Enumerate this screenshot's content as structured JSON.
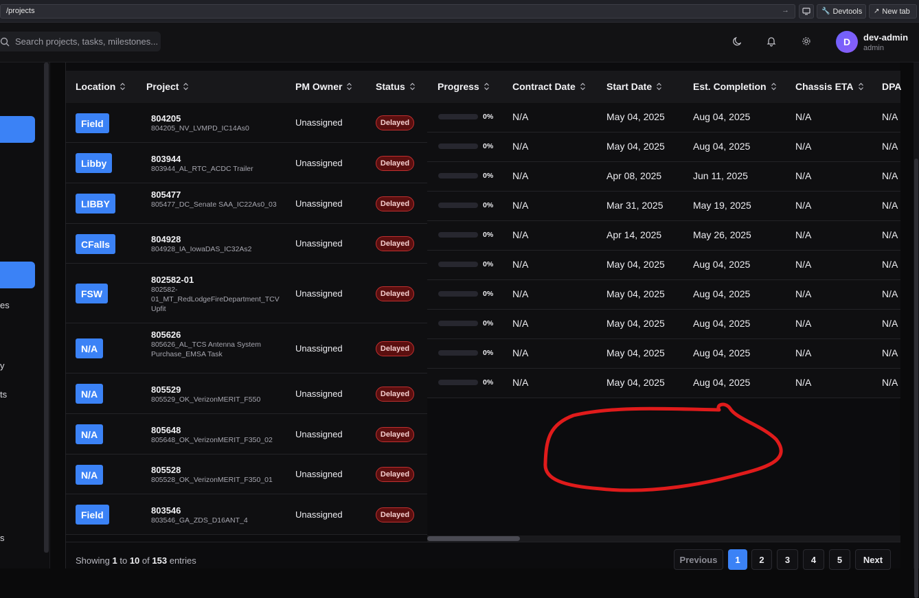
{
  "browser": {
    "url": "/projects",
    "devtools_label": "Devtools",
    "newtab_label": "New tab"
  },
  "header": {
    "search_placeholder": "Search projects, tasks, milestones...",
    "user_initial": "D",
    "user_name": "dev-admin",
    "user_role": "admin"
  },
  "sidebar": {
    "fragments": [
      "es",
      "y",
      "ts",
      "s"
    ]
  },
  "table": {
    "columns": [
      "Location",
      "Project",
      "PM Owner",
      "Status",
      "Progress",
      "Contract Date",
      "Start Date",
      "Est. Completion",
      "Chassis ETA",
      "DPA"
    ],
    "left_rows": [
      {
        "location": "Field",
        "id": "804205",
        "name": "804205_NV_LVMPD_IC14As0",
        "pm": "Unassigned",
        "status": "Delayed"
      },
      {
        "location": "Libby",
        "id": "803944",
        "name": "803944_AL_RTC_ACDC Trailer",
        "pm": "Unassigned",
        "status": "Delayed"
      },
      {
        "location": "LIBBY",
        "id": "805477",
        "name": "805477_DC_Senate SAA_IC22As0_03",
        "pm": "Unassigned",
        "status": "Delayed"
      },
      {
        "location": "CFalls",
        "id": "804928",
        "name": "804928_IA_IowaDAS_IC32As2",
        "pm": "Unassigned",
        "status": "Delayed"
      },
      {
        "location": "FSW",
        "id": "802582-01",
        "name": "802582-01_MT_RedLodgeFireDepartment_TCV Upfit",
        "pm": "Unassigned",
        "status": "Delayed"
      },
      {
        "location": "N/A",
        "id": "805626",
        "name": "805626_AL_TCS Antenna System Purchase_EMSA Task",
        "pm": "Unassigned",
        "status": "Delayed"
      },
      {
        "location": "N/A",
        "id": "805529",
        "name": "805529_OK_VerizonMERIT_F550",
        "pm": "Unassigned",
        "status": "Delayed"
      },
      {
        "location": "N/A",
        "id": "805648",
        "name": "805648_OK_VerizonMERIT_F350_02",
        "pm": "Unassigned",
        "status": "Delayed"
      },
      {
        "location": "N/A",
        "id": "805528",
        "name": "805528_OK_VerizonMERIT_F350_01",
        "pm": "Unassigned",
        "status": "Delayed"
      },
      {
        "location": "Field",
        "id": "803546",
        "name": "803546_GA_ZDS_D16ANT_4",
        "pm": "Unassigned",
        "status": "Delayed"
      }
    ],
    "right_rows": [
      {
        "progress": 0,
        "progress_label": "0%",
        "contract": "N/A",
        "start": "May 04, 2025",
        "est": "Aug 04, 2025",
        "chassis": "N/A",
        "dpa": "N/A"
      },
      {
        "progress": 0,
        "progress_label": "0%",
        "contract": "N/A",
        "start": "May 04, 2025",
        "est": "Aug 04, 2025",
        "chassis": "N/A",
        "dpa": "N/A"
      },
      {
        "progress": 0,
        "progress_label": "0%",
        "contract": "N/A",
        "start": "Apr 08, 2025",
        "est": "Jun 11, 2025",
        "chassis": "N/A",
        "dpa": "N/A"
      },
      {
        "progress": 0,
        "progress_label": "0%",
        "contract": "N/A",
        "start": "Mar 31, 2025",
        "est": "May 19, 2025",
        "chassis": "N/A",
        "dpa": "N/A"
      },
      {
        "progress": 0,
        "progress_label": "0%",
        "contract": "N/A",
        "start": "Apr 14, 2025",
        "est": "May 26, 2025",
        "chassis": "N/A",
        "dpa": "N/A"
      },
      {
        "progress": 0,
        "progress_label": "0%",
        "contract": "N/A",
        "start": "May 04, 2025",
        "est": "Aug 04, 2025",
        "chassis": "N/A",
        "dpa": "N/A"
      },
      {
        "progress": 0,
        "progress_label": "0%",
        "contract": "N/A",
        "start": "May 04, 2025",
        "est": "Aug 04, 2025",
        "chassis": "N/A",
        "dpa": "N/A"
      },
      {
        "progress": 0,
        "progress_label": "0%",
        "contract": "N/A",
        "start": "May 04, 2025",
        "est": "Aug 04, 2025",
        "chassis": "N/A",
        "dpa": "N/A"
      },
      {
        "progress": 0,
        "progress_label": "0%",
        "contract": "N/A",
        "start": "May 04, 2025",
        "est": "Aug 04, 2025",
        "chassis": "N/A",
        "dpa": "N/A"
      },
      {
        "progress": 0,
        "progress_label": "0%",
        "contract": "N/A",
        "start": "May 04, 2025",
        "est": "Aug 04, 2025",
        "chassis": "N/A",
        "dpa": "N/A"
      }
    ]
  },
  "pagination": {
    "showing_prefix": "Showing",
    "from": "1",
    "to_word": "to",
    "to": "10",
    "of_word": "of",
    "total": "153",
    "suffix": "entries",
    "previous": "Previous",
    "pages": [
      "1",
      "2",
      "3",
      "4",
      "5"
    ],
    "current_page": "1",
    "next": "Next"
  },
  "colors": {
    "accent": "#3b82f6",
    "status_delayed_bg": "#5a0f0f",
    "status_delayed_border": "#c23030",
    "annotation": "#e01b1b"
  }
}
